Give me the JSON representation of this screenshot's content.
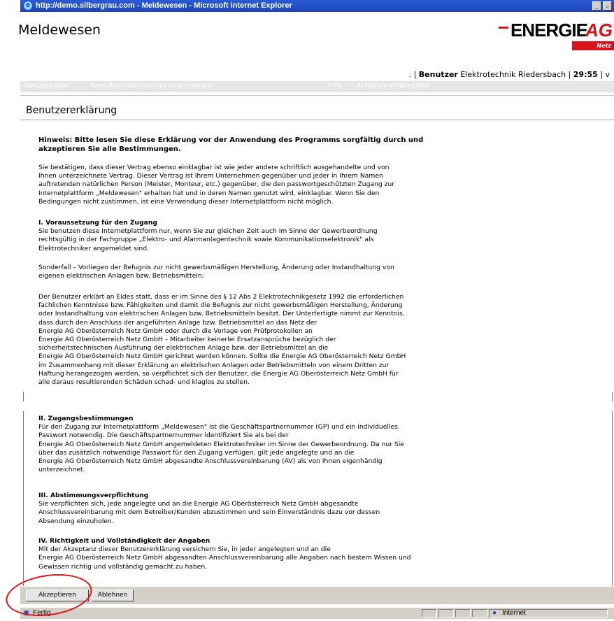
{
  "window": {
    "title": "http://demo.silbergrau.com - Meldewesen - Microsoft Internet Explorer"
  },
  "header": {
    "app_name": "Meldewesen",
    "logo": {
      "word": "ENERGIE",
      "ag": "AG",
      "sub": "Netz"
    },
    "user_line": {
      "prefix": ". |",
      "label": "Benutzer",
      "user": "Elektrotechnik Riedersbach",
      "sep": "|",
      "timer": "29:55",
      "suffix": "| v"
    }
  },
  "nav": {
    "items": [
      "Administration",
      "Neue Anschlussvereinbarung erstellen",
      "Hilfe",
      "Aktualisieren",
      "Abmelden"
    ]
  },
  "page_title": "Benutzererklärung",
  "hint": [
    "Hinweis: Bitte lesen Sie diese Erklärung vor der Anwendung des Programms sorgfältig durch und",
    "akzeptieren Sie alle Bestimmungen."
  ],
  "intro": [
    "Sie bestätigen, dass dieser Vertrag ebenso einklagbar ist wie jeder andere schriftlich ausgehandelte und von",
    "Ihnen unterzeichnete Vertrag. Dieser Vertrag ist Ihrem Unternehmen gegenüber und jeder in Ihrem Namen",
    "auftretenden natürlichen Person (Meister, Monteur, etc.) gegenüber, die den passwortgeschützten Zugang zur",
    "Internetplattform „Meldewesen\" erhalten hat und in deren Namen genutzt wird, einklagbar. Wenn Sie den",
    "Bedingungen nicht zustimmen, ist eine Verwendung dieser Internetplattform nicht möglich."
  ],
  "section1": {
    "title": "I. Voraussetzung für den Zugang",
    "lines": [
      "Sie benutzen diese Internetplattform nur, wenn Sie zur gleichen Zeit auch im Sinne der Gewerbeordnung",
      "rechtsgültig in der Fachgruppe „Elektro- und Alarmanlagentechnik sowie Kommunikationselektronik\" als",
      "Elektrotechniker angemeldet sind."
    ],
    "special": [
      "Sonderfall – Vorliegen der Befugnis zur nicht gewerbsmäßigen Herstellung, Änderung oder Instandhaltung von",
      "eigenen elektrischen Anlagen bzw. Betriebsmitteln:"
    ],
    "declaration": [
      "Der Benutzer erklärt an Eides statt, dass er im Sinne des § 12 Abs 2  Elektrotechnikgesetz 1992 die erforderlichen",
      "fachlichen Kenntnisse bzw. Fähigkeiten und damit die Befugnis zur nicht gewerbsmäßigen Herstellung, Änderung",
      "oder Instandhaltung von elektrischen Anlagen bzw. Betriebsmitteln besitzt. Der Unterfertigte nimmt zur Kenntnis,",
      "dass durch den Anschluss der angeführten Anlage bzw. Betriebsmittel an das Netz der",
      "Energie AG Oberösterreich Netz GmbH oder durch die Vorlage von Prüfprotokollen an",
      "Energie AG Oberösterreich Netz GmbH – Mitarbeiter keinerlei Ersatzansprüche bezüglich der",
      "sicherheitstechnischen Ausführung der elektrischen Anlage bzw. der Betriebsmittel an die",
      "Energie AG Oberösterreich Netz GmbH gerichtet werden können. Sollte die Energie AG Oberösterreich Netz GmbH",
      "im Zusammenhang mit dieser Erklärung an elektrischen Anlagen oder Betriebsmitteln von einem Dritten zur",
      "Haftung herangezogen werden, so verpflichtet sich der Benutzer, die Energie AG Oberösterreich Netz GmbH für",
      "alle daraus resultierenden Schäden schad- und klaglos zu stellen."
    ]
  },
  "section2": {
    "title": "II. Zugangsbestimmungen",
    "lines": [
      "Für den Zugang zur Internetplattform „Meldewesen\" ist die Geschäftspartnernummer (GP) und ein individuelles",
      "Passwort notwendig. Die Geschäftspartnernummer identifiziert Sie als bei der",
      "Energie AG Oberösterreich Netz GmbH angemeldeten Elektrotechniker im Sinne der Gewerbeordnung. Da nur Sie",
      "über das zusätzlich notwendige Passwort für den Zugang verfügen, gilt jede angelegte und an die",
      "Energie AG Oberösterreich Netz GmbH abgesandte Anschlussvereinbarung (AV) als von Ihnen eigenhändig",
      "unterzeichnet."
    ]
  },
  "section3": {
    "title": "III. Abstimmungsverpflichtung",
    "lines": [
      "Sie verpflichten sich, jede angelegte und an die Energie AG Oberösterreich Netz GmbH abgesandte",
      "Anschlussvereinbarung mit dem Betreiber/Kunden abzustimmen und sein Einverständnis dazu vor dessen",
      "Absendung einzuholen."
    ]
  },
  "section4": {
    "title": "IV. Richtigkeit und Vollständigkeit der Angaben",
    "lines": [
      "Mit der Akzeptanz dieser Benutzererklärung versichern Sie, in jeder angelegten und an die",
      "Energie AG Oberösterreich Netz GmbH abgesandten Anschlussvereinbarung alle Angaben nach bestem Wissen und",
      "Gewissen richtig und vollständig gemacht zu haben."
    ]
  },
  "buttons": {
    "accept": "Akzeptieren",
    "decline": "Ablehnen"
  },
  "status": {
    "text": "Fertig",
    "zone": "Internet"
  },
  "colors": {
    "titlebar": "#1c46b8",
    "brand_red": "#d7141c",
    "annotation": "#e0141c"
  }
}
